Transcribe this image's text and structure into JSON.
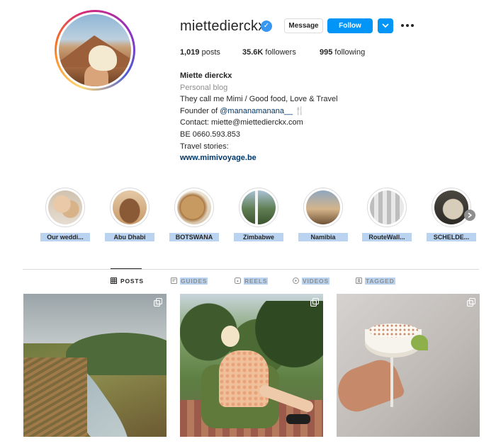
{
  "profile": {
    "username": "miettedierckx",
    "verified_icon": "check",
    "message_label": "Message",
    "follow_label": "Follow",
    "posts_count": "1,019",
    "posts_label": " posts",
    "followers_count": "35.6K",
    "followers_label": " followers",
    "following_count": "995",
    "following_label": " following"
  },
  "bio": {
    "name": "Miette dierckx",
    "category": "Personal blog",
    "line1": "They call me Mimi / Good food, Love & Travel",
    "line2_prefix": "Founder of ",
    "line2_mention": "@mananamanana__",
    "line2_emoji": " 🍴",
    "line3": "Contact: miette@miettedierckx.com",
    "line4": "BE 0660.593.853",
    "line5": "Travel stories:",
    "link": "www.mimivoyage.be"
  },
  "highlights": [
    {
      "label": "Our weddi..."
    },
    {
      "label": "Abu Dhabi"
    },
    {
      "label": "BOTSWANA"
    },
    {
      "label": "Zimbabwe"
    },
    {
      "label": "Namibia"
    },
    {
      "label": "RouteWall..."
    },
    {
      "label": "SCHELDE..."
    }
  ],
  "tabs": {
    "posts": "POSTS",
    "guides": "GUIDES",
    "reels": "REELS",
    "videos": "VIDEOS",
    "tagged": "TAGGED"
  },
  "colors": {
    "accent": "#0095f6",
    "text": "#262626",
    "muted": "#8e8e8e",
    "link": "#00376b"
  }
}
